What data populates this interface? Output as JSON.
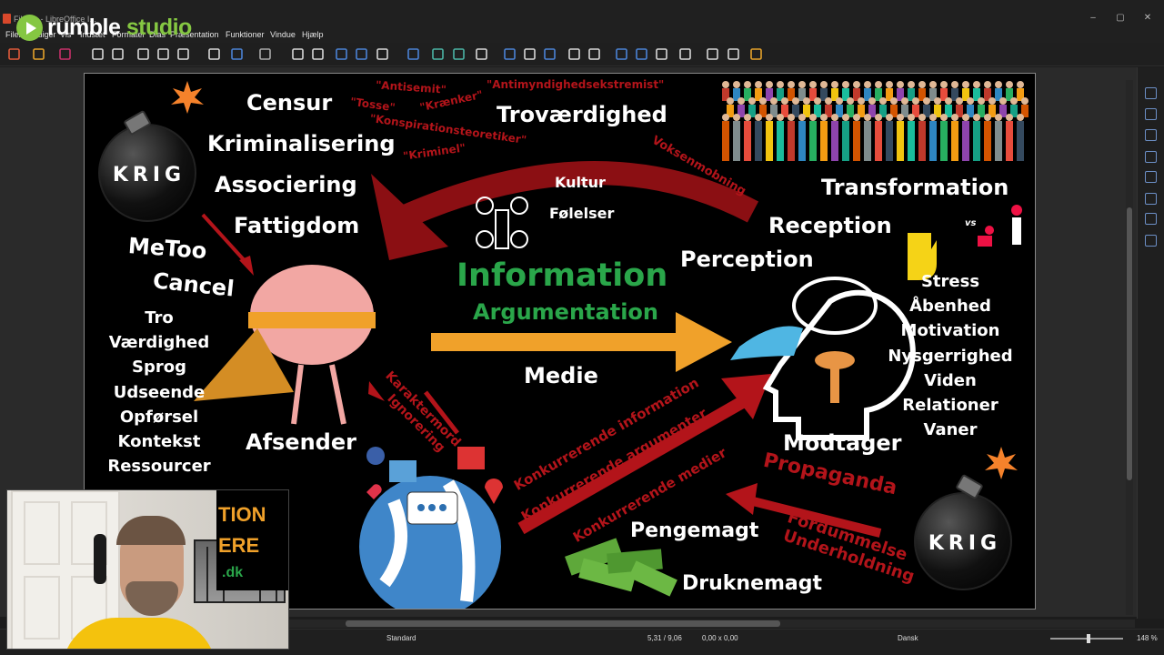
{
  "window": {
    "title": "Fil...dp - LibreOffice I...",
    "controls": [
      "–",
      "▢",
      "✕"
    ]
  },
  "logo": {
    "brand": "rumble",
    "suffix": "studio"
  },
  "menu": [
    "Filer",
    "Rediger",
    "Vis",
    "Indsæt",
    "Formater",
    "Dias",
    "Præsentation",
    "Funktioner",
    "Vindue",
    "Hjælp"
  ],
  "toolbar": {
    "icons": [
      "new-icon",
      "open-icon",
      "save-icon",
      "pdf-icon",
      "print-icon",
      "cut-icon",
      "copy-icon",
      "paste-icon",
      "clone-icon",
      "undo-icon",
      "redo-icon",
      "find-icon",
      "spelling-icon",
      "grid-icon",
      "helplines-icon",
      "display-icon",
      "master-icon",
      "slide-start-icon",
      "slide-current-icon",
      "table-icon",
      "image-icon",
      "media-icon",
      "chart-icon",
      "textbox-icon",
      "special-char-icon",
      "fontwork-icon",
      "hyperlink-icon",
      "shapes-icon",
      "show-icon",
      "duplicate-icon",
      "delete-icon",
      "layout-icon"
    ]
  },
  "slide": {
    "bombs": [
      {
        "label": "KRIG"
      },
      {
        "label": "KRIG"
      }
    ],
    "left_top": [
      "Censur",
      "Kriminalisering",
      "Associering",
      "Fattigdom"
    ],
    "left_mid": [
      "MeToo",
      "Cancel"
    ],
    "left_list": [
      "Tro",
      "Værdighed",
      "Sprog",
      "Udseende",
      "Opførsel",
      "Kontekst",
      "Ressourcer"
    ],
    "insults": [
      "\"Antisemit\"",
      "\"Tosse\"",
      "\"Krænker\"",
      "\"Antimyndighedsekstremist\"",
      "\"Konspirationsteoretiker\"",
      "\"Kriminel\""
    ],
    "center_top": "Troværdighed",
    "voksen": "Voksenmobning",
    "kultur": "Kultur",
    "foelelser": "Følelser",
    "information": "Information",
    "argumentation": "Argumentation",
    "medie": "Medie",
    "afsender": "Afsender",
    "modtager": "Modtager",
    "right_top": [
      "Transformation",
      "Reception",
      "Perception"
    ],
    "vs": "vs",
    "right_list": [
      "Stress",
      "Åbenhed",
      "Motivation",
      "Nysgerrighed",
      "Viden",
      "Relationer",
      "Vaner"
    ],
    "karakter": [
      "Karaktermord",
      "Ignorering"
    ],
    "konkurrerende": [
      "Konkurrerende information",
      "Konkurrerende argumenter",
      "Konkurrerende medier"
    ],
    "propaganda": "Propaganda",
    "fordummelse": [
      "Fordummelse",
      "Underholdning"
    ],
    "pengemagt": "Pengemagt",
    "druknemagt": "Druknemagt"
  },
  "webcam": {
    "overlay": [
      "TION",
      "ERE",
      ".dk"
    ]
  },
  "status": {
    "layout": "Standard",
    "position": "5,31 / 9,06",
    "size": "0,00 x 0,00",
    "language": "Dansk",
    "zoom": "148 %"
  },
  "colors": {
    "slide_bg": "#000000",
    "red": "#b3141a",
    "green": "#2aa64a",
    "orange": "#f0a12a",
    "logo_green": "#85c742",
    "webcam_shirt": "#f4c20d"
  }
}
